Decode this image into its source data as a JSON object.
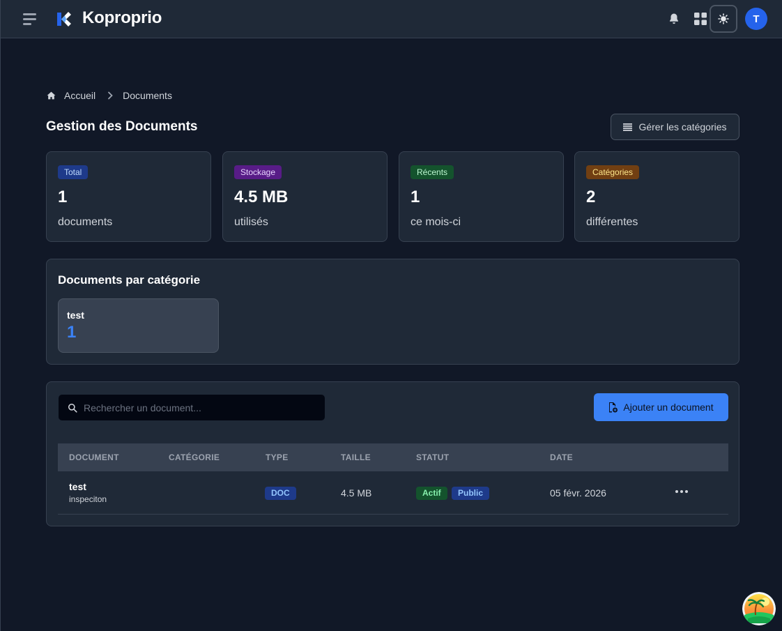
{
  "app": {
    "name": "Koproprio",
    "user_initial": "T"
  },
  "breadcrumb": {
    "home": "Accueil",
    "current": "Documents"
  },
  "header": {
    "title": "Gestion des Documents",
    "manage_categories": "Gérer les catégories"
  },
  "stats": [
    {
      "badge": "Total",
      "value": "1",
      "label": "documents",
      "color": "#1e3a8a",
      "text_color": "#bfdbfe"
    },
    {
      "badge": "Stockage",
      "value": "4.5 MB",
      "label": "utilisés",
      "color": "#581c87",
      "text_color": "#e9d5ff"
    },
    {
      "badge": "Récents",
      "value": "1",
      "label": "ce mois-ci",
      "color": "#14532d",
      "text_color": "#bbf7d0"
    },
    {
      "badge": "Catégories",
      "value": "2",
      "label": "différentes",
      "color": "#713f12",
      "text_color": "#fde68a"
    }
  ],
  "categories_panel": {
    "title": "Documents par catégorie",
    "items": [
      {
        "name": "test",
        "count": "1"
      }
    ]
  },
  "documents": {
    "search_placeholder": "Rechercher un document...",
    "add_label": "Ajouter un document",
    "columns": [
      "DOCUMENT",
      "CATÉGORIE",
      "TYPE",
      "TAILLE",
      "STATUT",
      "DATE"
    ],
    "rows": [
      {
        "name": "test",
        "description": "inspeciton",
        "category": "",
        "type": "DOC",
        "size": "4.5 MB",
        "status": "Actif",
        "visibility": "Public",
        "date": "05 févr. 2026"
      }
    ]
  },
  "colors": {
    "accent": "#3b82f6",
    "background": "#111827",
    "card": "#1f2937"
  },
  "icons": [
    "menu-icon",
    "logo-icon",
    "bell-icon",
    "apps-grid-icon",
    "sun-icon",
    "home-icon",
    "chevron-right-icon",
    "list-icon",
    "search-icon",
    "file-plus-icon",
    "more-horizontal-icon",
    "beach-icon"
  ]
}
